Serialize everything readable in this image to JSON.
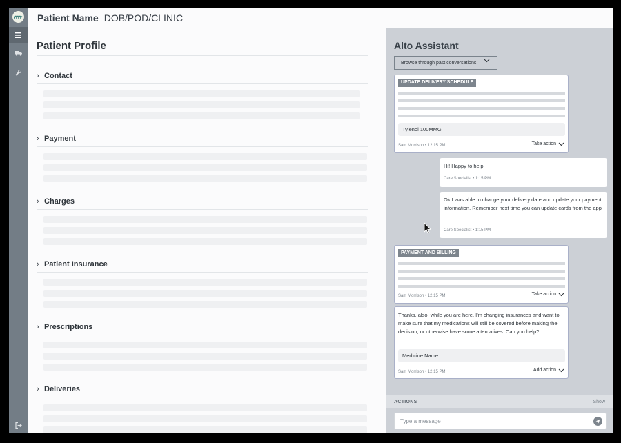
{
  "header": {
    "patient_name": "Patient Name",
    "patient_meta": "DOB/POD/CLINIC"
  },
  "rail": {
    "items": [
      "menu-icon",
      "truck-icon",
      "wrench-icon"
    ],
    "footer": "logout-icon"
  },
  "profile": {
    "title": "Patient Profile",
    "sections": [
      {
        "label": "Contact"
      },
      {
        "label": "Payment"
      },
      {
        "label": "Charges"
      },
      {
        "label": "Patient Insurance"
      },
      {
        "label": "Prescriptions"
      },
      {
        "label": "Deliveries"
      }
    ]
  },
  "assistant": {
    "title": "Alto Assistant",
    "browse_label": "Browse through past conversations",
    "cards": {
      "delivery": {
        "tag": "UPDATE DELIVERY SCHEDULE",
        "chip": "Tylenol 100MMG",
        "author": "Sam Morrison",
        "time": "12:15 PM",
        "action": "Take action"
      },
      "billing": {
        "tag": "PAYMENT AND BILLING",
        "author": "Sam Morrison",
        "time": "12:15 PM",
        "action": "Take action"
      },
      "insurance": {
        "message": "Thanks, also. while you are here. I'm changing insurances and want to make sure that my medications will still be covered before making the decision, or otherwise have some alternatives. Can you help?",
        "chip": "Medicine Name",
        "author": "Sam Morrison",
        "time": "12:15 PM",
        "action": "Add action"
      }
    },
    "replies": [
      {
        "text": "Hi! Happy to help.",
        "author": "Care Specialist",
        "time": "1:15 PM"
      },
      {
        "text": "Ok I was able to change your delivery date and update your payment information. Remember next time you can update cards from the app",
        "author": "Care Specialist",
        "time": "1:15 PM"
      }
    ],
    "actions_label": "ACTIONS",
    "show_label": "Show",
    "composer_placeholder": "Type a message",
    "meta_separator": "•"
  },
  "colors": {
    "rail": "#737d86",
    "panel": "#ccd0d6",
    "tag": "#7d858d",
    "card_border": "#a9b0c8"
  }
}
